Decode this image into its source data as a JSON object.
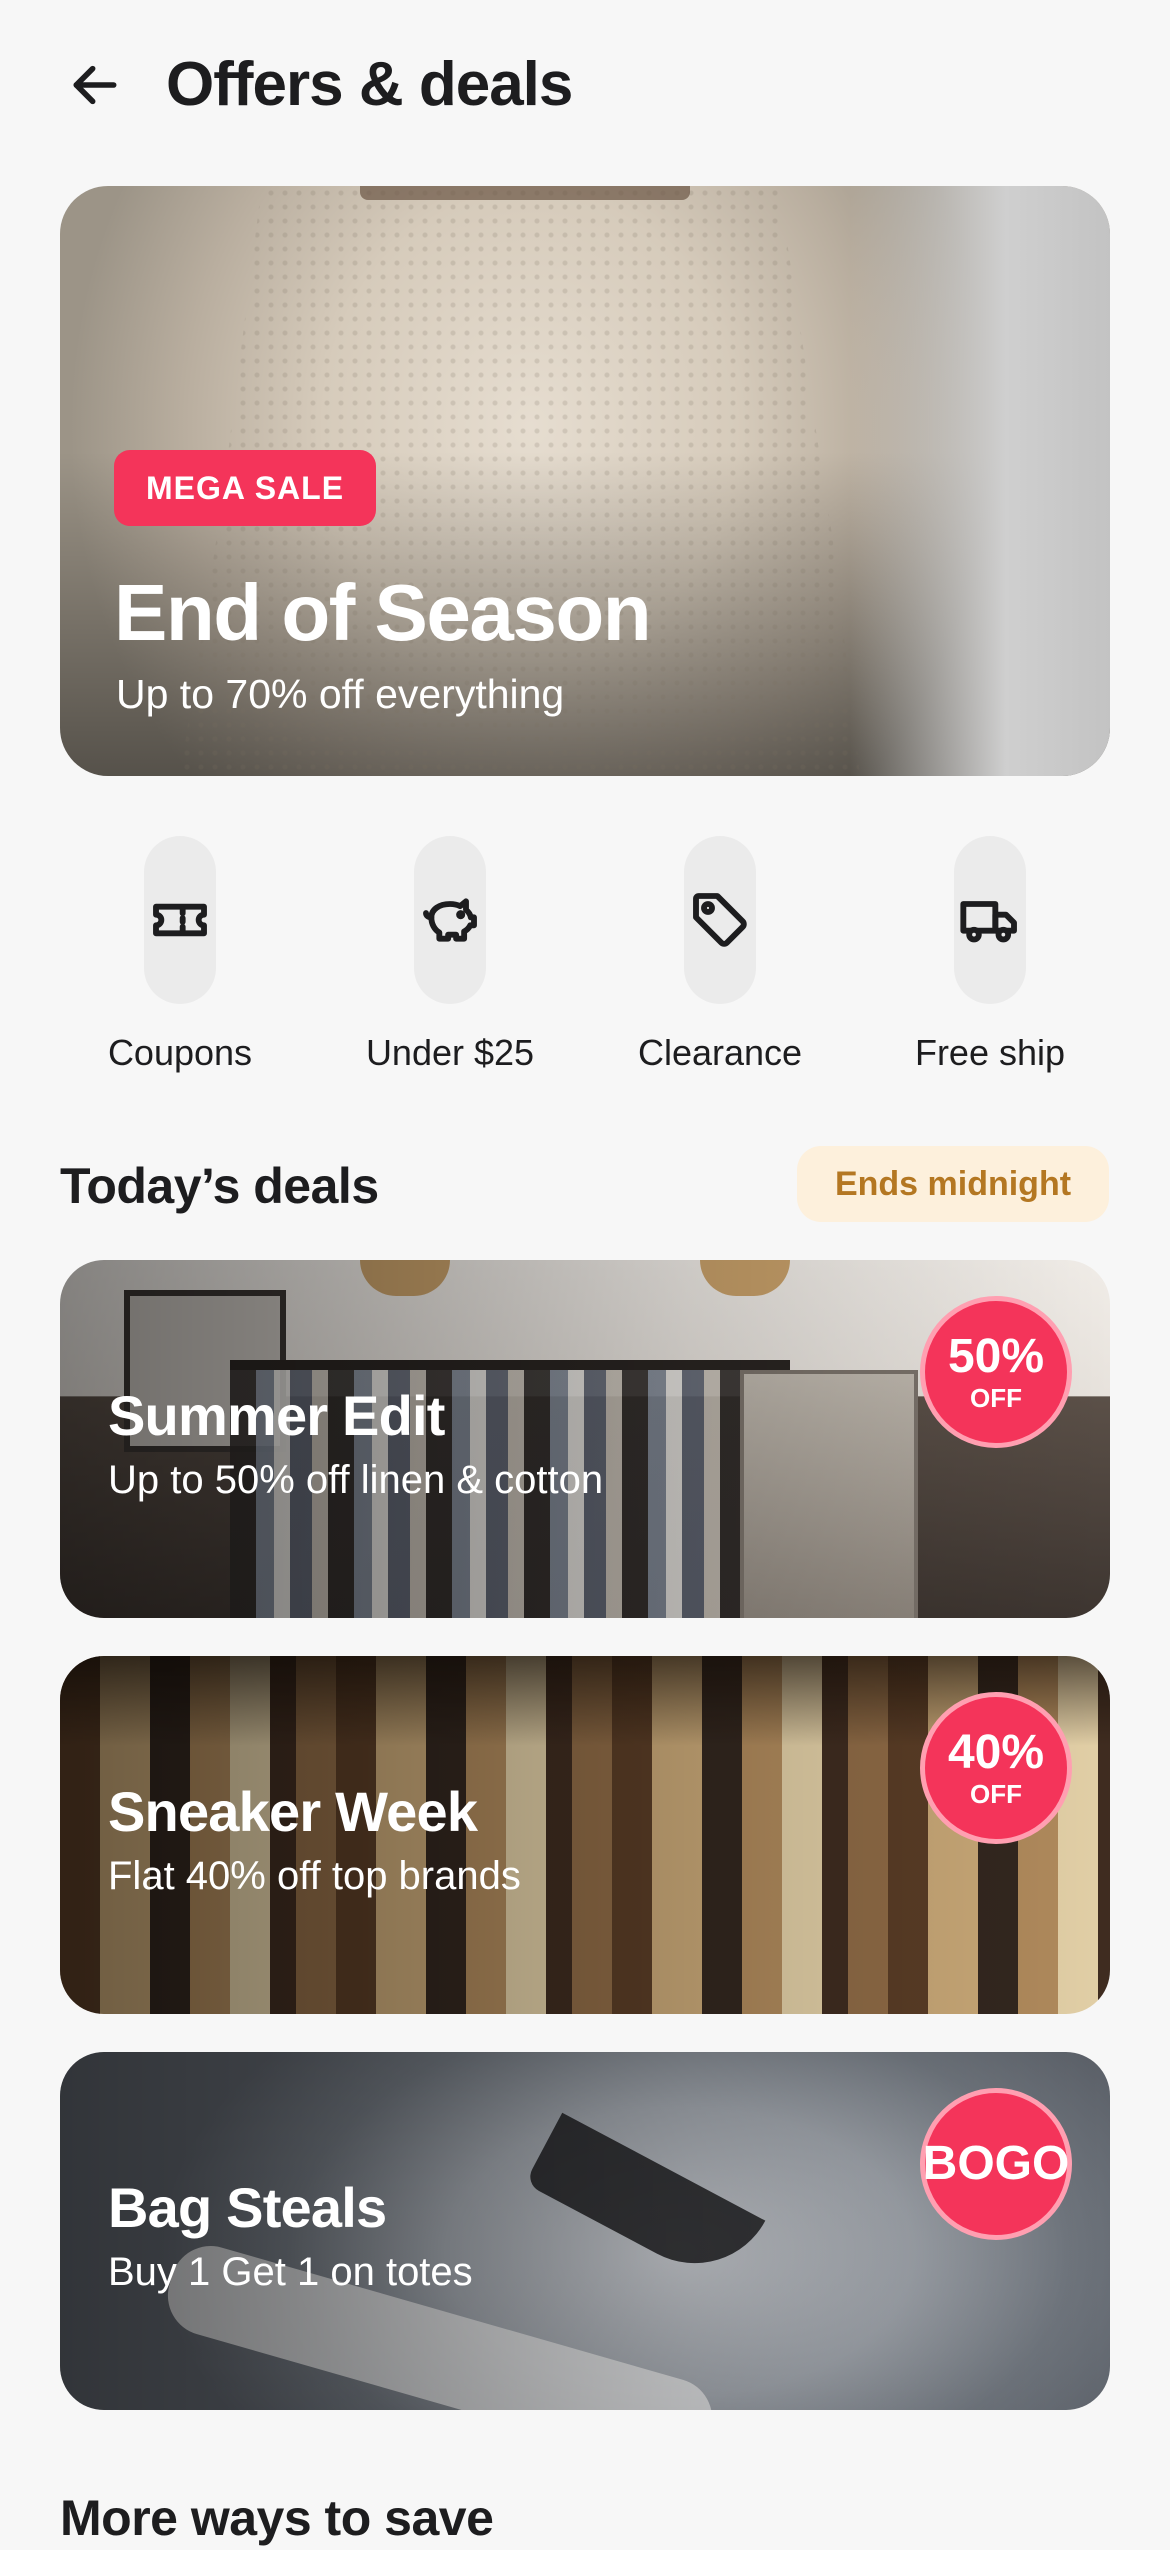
{
  "header": {
    "title": "Offers & deals"
  },
  "hero": {
    "badge": "MEGA SALE",
    "title": "End of Season",
    "subtitle": "Up to 70% off everything"
  },
  "quick_actions": [
    {
      "label": "Coupons",
      "icon": "ticket-icon"
    },
    {
      "label": "Under $25",
      "icon": "piggy-bank-icon"
    },
    {
      "label": "Clearance",
      "icon": "tag-icon"
    },
    {
      "label": "Free ship",
      "icon": "truck-icon"
    }
  ],
  "todays_deals": {
    "title": "Today’s deals",
    "ends": "Ends midnight",
    "items": [
      {
        "title": "Summer Edit",
        "subtitle": "Up to 50% off linen & cotton",
        "badge_main": "50%",
        "badge_sub": "OFF"
      },
      {
        "title": "Sneaker Week",
        "subtitle": "Flat 40% off top brands",
        "badge_main": "40%",
        "badge_sub": "OFF"
      },
      {
        "title": "Bag Steals",
        "subtitle": "Buy 1 Get 1 on totes",
        "badge_main": "BOGO",
        "badge_sub": ""
      }
    ]
  },
  "more": {
    "title": "More ways to save"
  },
  "colors": {
    "accent": "#f4345a",
    "ends_bg": "#fdf0dc",
    "ends_text": "#b47722",
    "background": "#f7f7f7"
  }
}
